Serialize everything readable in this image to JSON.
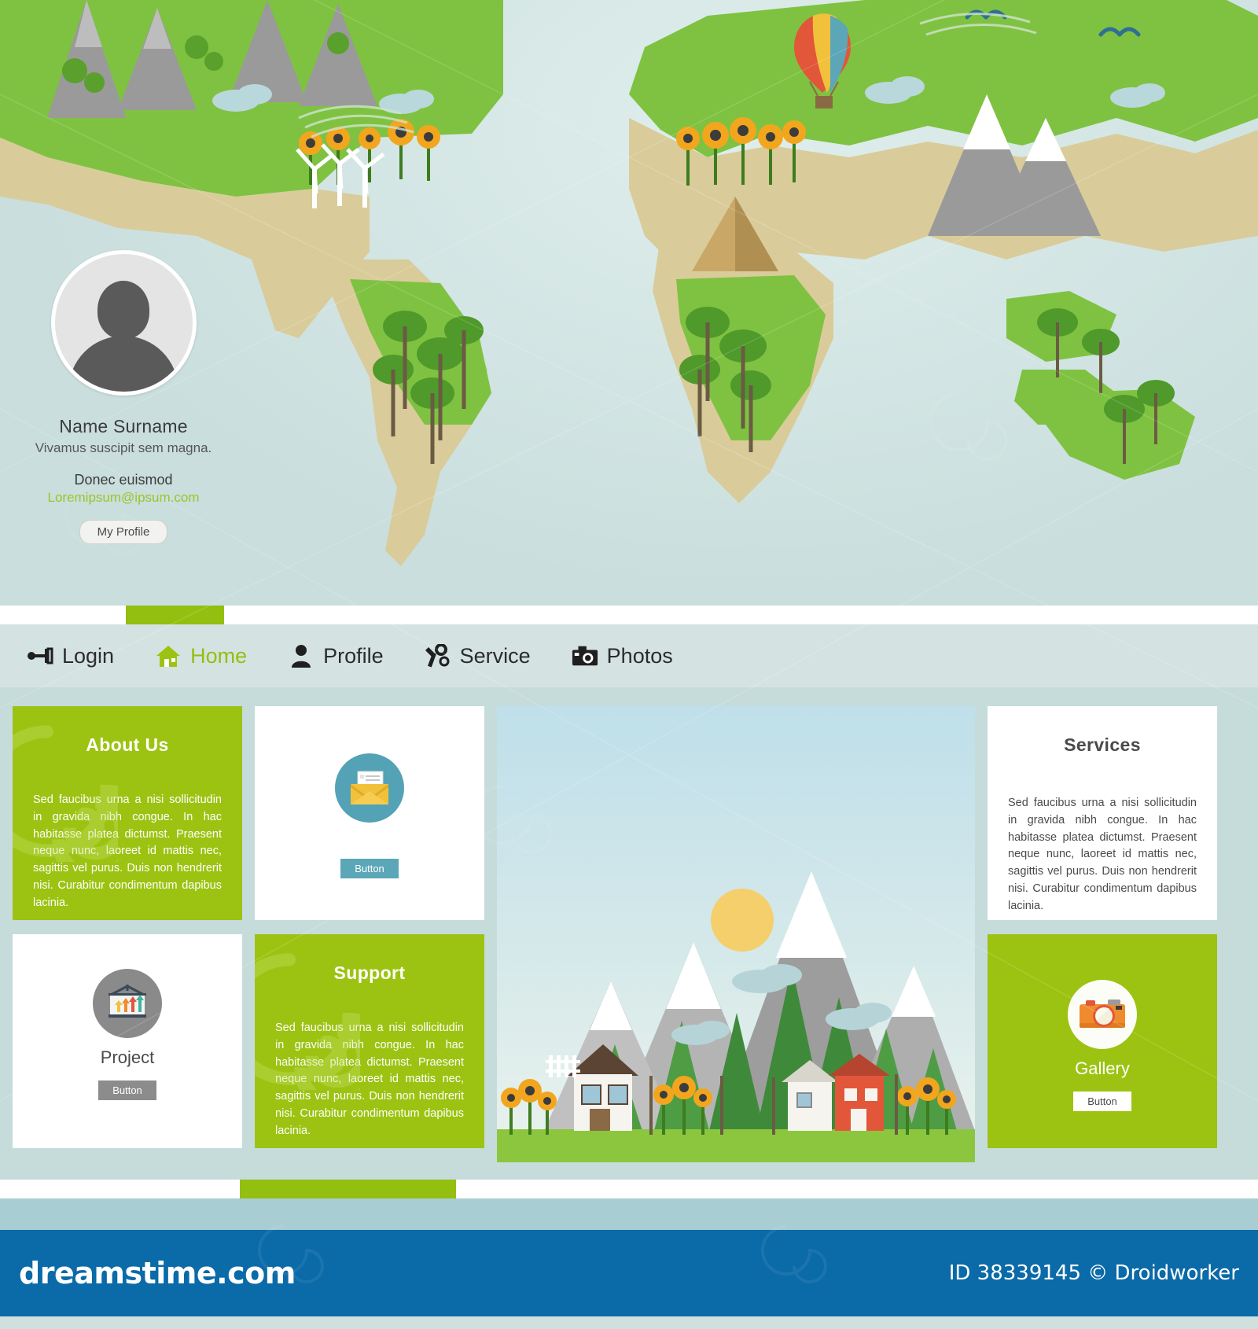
{
  "profile": {
    "name": "Name Surname",
    "tagline": "Vivamus suscipit sem magna.",
    "subtitle": "Donec euismod",
    "email": "Loremipsum@ipsum.com",
    "button_label": "My Profile",
    "avatar_icon": "user-avatar-icon"
  },
  "nav": {
    "items": [
      {
        "label": "Login",
        "icon": "key-icon",
        "active": false
      },
      {
        "label": "Home",
        "icon": "house-icon",
        "active": true
      },
      {
        "label": "Profile",
        "icon": "person-icon",
        "active": false
      },
      {
        "label": "Service",
        "icon": "tools-icon",
        "active": false
      },
      {
        "label": "Photos",
        "icon": "camera-icon",
        "active": false
      }
    ]
  },
  "body_text": "Sed faucibus urna a nisi sollicitudin in gravida nibh congue. In hac habitasse platea dictumst. Praesent neque nunc, laoreet id mattis nec, sagittis vel purus. Duis non hendrerit nisi. Curabitur condimentum dapibus lacinia.",
  "cards": {
    "about": {
      "title": "About Us",
      "text": "Sed faucibus urna a nisi sollicitudin in gravida nibh congue. In hac habitasse platea dictumst. Praesent neque nunc, laoreet id mattis nec, sagittis vel purus. Duis non hendrerit nisi. Curabitur condimentum dapibus lacinia."
    },
    "mail": {
      "icon": "envelope-mail-icon",
      "button_label": "Button"
    },
    "services": {
      "title": "Services",
      "text": "Sed faucibus urna a nisi sollicitudin in gravida nibh congue. In hac habitasse platea dictumst. Praesent neque nunc, laoreet id mattis nec, sagittis vel purus. Duis non hendrerit nisi. Curabitur condimentum dapibus lacinia."
    },
    "project": {
      "icon": "presentation-chart-icon",
      "label": "Project",
      "button_label": "Button"
    },
    "support": {
      "title": "Support",
      "text": "Sed faucibus urna a nisi sollicitudin in gravida nibh congue. In hac habitasse platea dictumst. Praesent neque nunc, laoreet id mattis nec, sagittis vel purus. Duis non hendrerit nisi. Curabitur condimentum dapibus lacinia."
    },
    "gallery": {
      "icon": "photo-camera-icon",
      "label": "Gallery",
      "button_label": "Button"
    },
    "landscape": {
      "icon": "mountain-village-illustration"
    }
  },
  "footer": {
    "site_logo": "dreamstime.com",
    "credit": "ID 38339145 © Droidworker"
  },
  "colors": {
    "accent_green": "#9cc312",
    "strip_green": "#93bf10",
    "teal": "#54a2b5",
    "gray": "#8a8a8a",
    "page_bg": "#c5dcdb",
    "hero_bg": "#d4e3e1",
    "watermark_blue": "#0b6aa8"
  }
}
